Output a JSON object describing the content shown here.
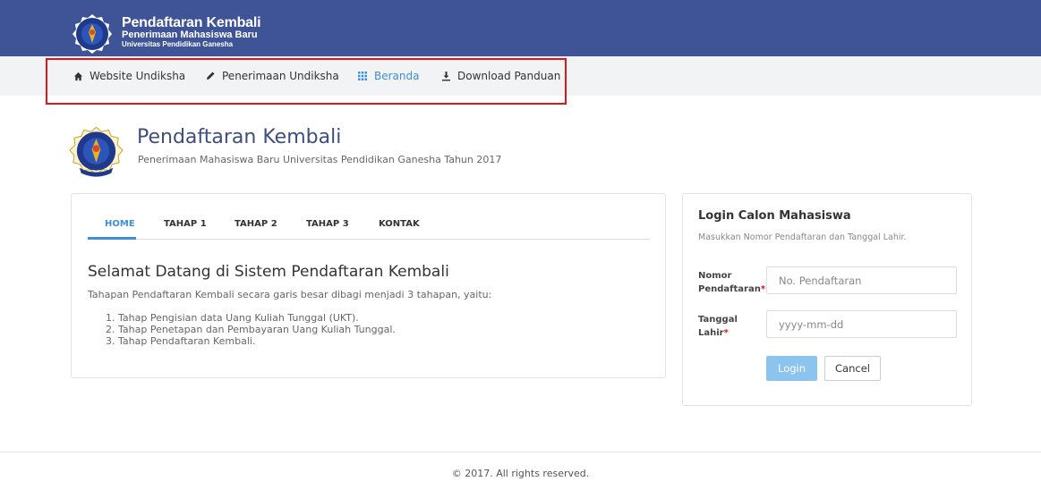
{
  "brand": {
    "title": "Pendaftaran Kembali",
    "line2": "Penerimaan Mahasiswa Baru",
    "line3": "Universitas Pendidikan Ganesha"
  },
  "nav": {
    "items": [
      {
        "label": "Website Undiksha",
        "icon": "home-icon"
      },
      {
        "label": "Penerimaan Undiksha",
        "icon": "pencil-icon"
      },
      {
        "label": "Beranda",
        "icon": "grid-icon",
        "active": true
      },
      {
        "label": "Download Panduan",
        "icon": "download-icon"
      }
    ]
  },
  "header": {
    "title": "Pendaftaran Kembali",
    "subtitle": "Penerimaan Mahasiswa Baru Universitas Pendidikan Ganesha Tahun 2017"
  },
  "tabs": [
    "HOME",
    "TAHAP 1",
    "TAHAP 2",
    "TAHAP 3",
    "KONTAK"
  ],
  "content": {
    "heading": "Selamat Datang di Sistem Pendaftaran Kembali",
    "intro": "Tahapan Pendaftaran Kembali secara garis besar dibagi menjadi 3 tahapan, yaitu:",
    "steps": [
      "1. Tahap Pengisian data Uang Kuliah Tunggal (UKT).",
      "2. Tahap Penetapan dan Pembayaran Uang Kuliah Tunggal.",
      "3. Tahap Pendaftaran Kembali."
    ]
  },
  "login": {
    "title": "Login Calon Mahasiswa",
    "help": "Masukkan Nomor Pendaftaran dan Tanggal Lahir.",
    "nomor_label_1": "Nomor",
    "nomor_label_2": "Pendaftaran",
    "nomor_placeholder": "No. Pendaftaran",
    "tanggal_label_1": "Tanggal",
    "tanggal_label_2": "Lahir",
    "tanggal_placeholder": "yyyy-mm-dd",
    "required_mark": "*",
    "login_button": "Login",
    "cancel_button": "Cancel"
  },
  "footer": {
    "text": "© 2017. All rights reserved."
  },
  "colors": {
    "topbar": "#3f5496",
    "accent": "#3d8fd9",
    "highlight": "#e0151b"
  }
}
